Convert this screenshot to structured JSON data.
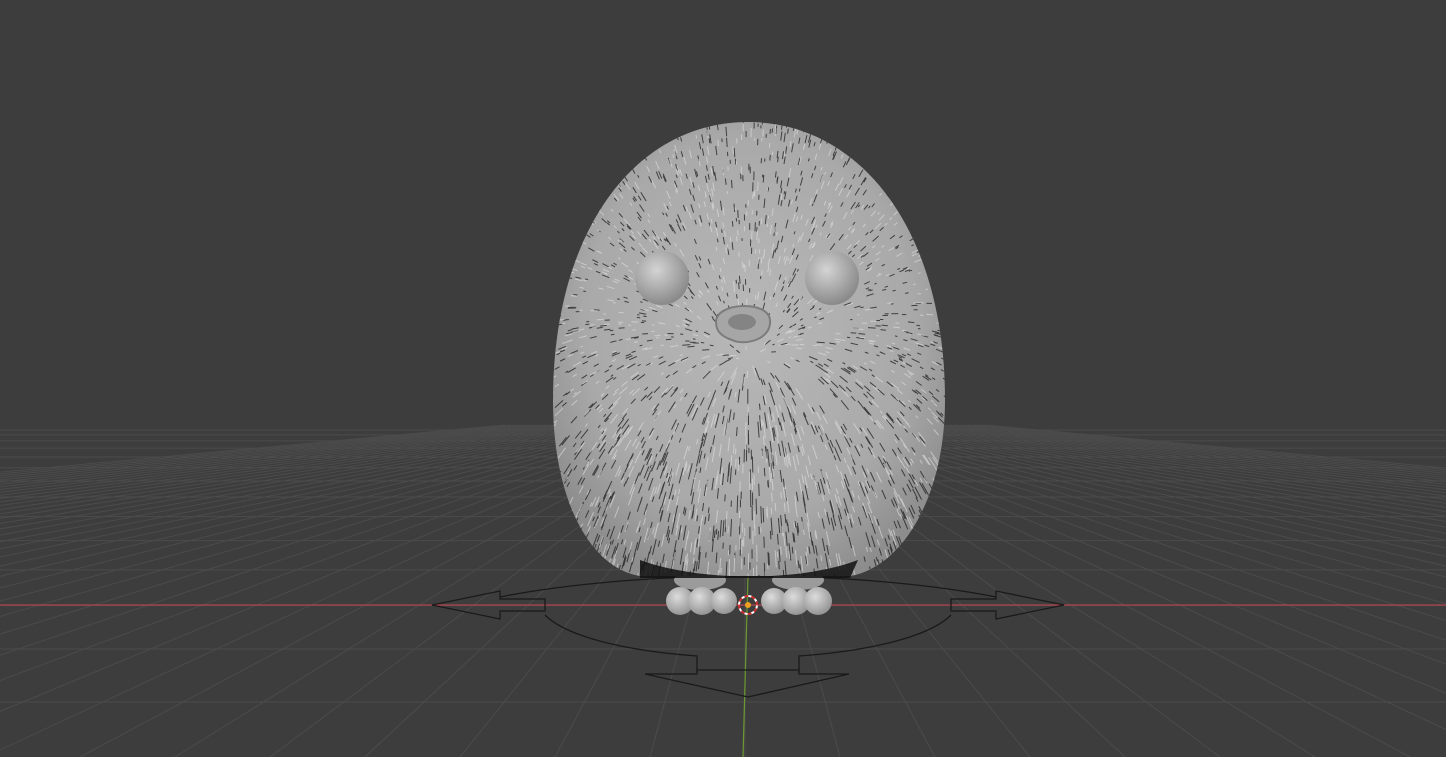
{
  "viewport": {
    "background": "#3d3d3d",
    "grid_color": "#4b4b4b",
    "x_axis_color": "#b0434b",
    "y_axis_color": "#6b9a30"
  },
  "object": {
    "type": "fur-penguin-character",
    "shade": "#bdbdbd"
  },
  "widgets": {
    "transform_gizmo": "move-arrows-gizmo",
    "cursor_3d": "3d-cursor-icon"
  }
}
